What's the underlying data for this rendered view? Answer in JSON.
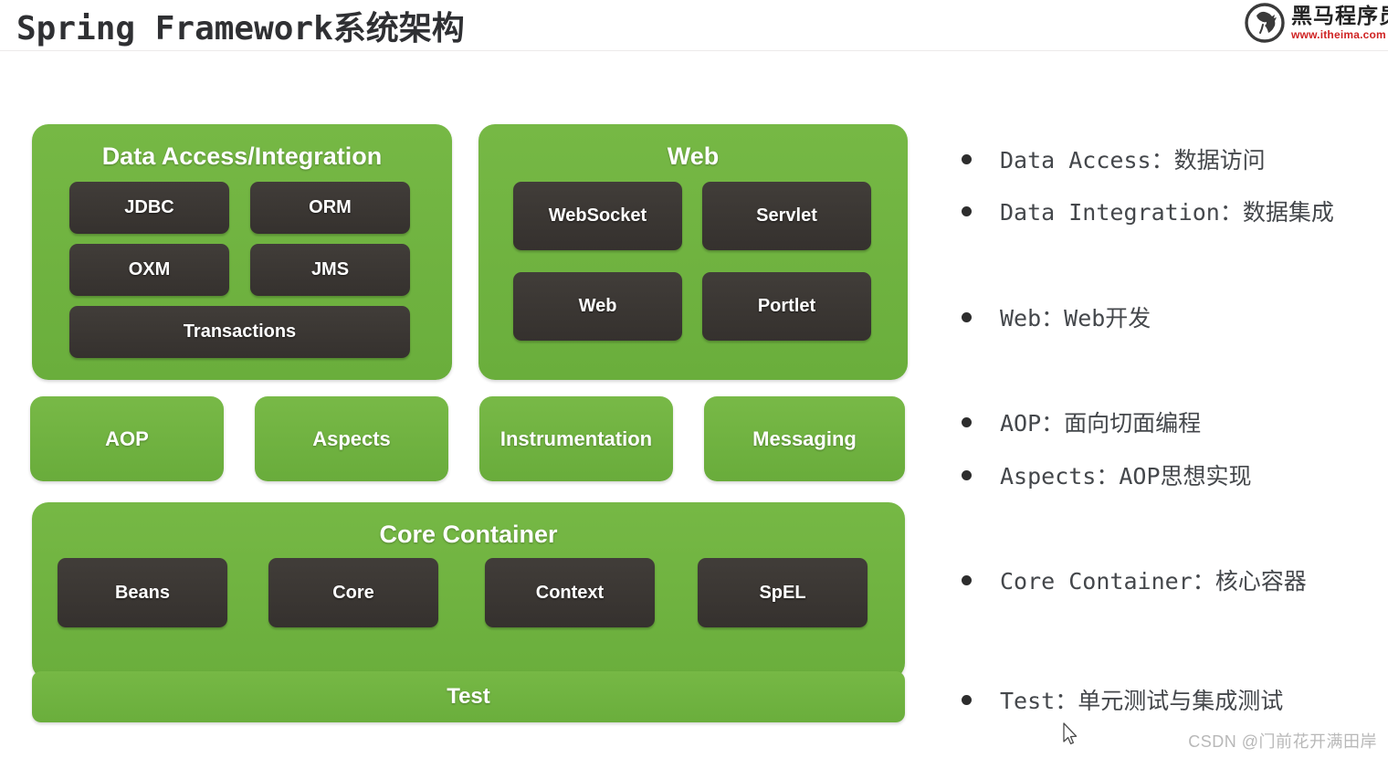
{
  "header": {
    "title": "Spring Framework系统架构",
    "brand": {
      "name": "黑马程序员",
      "url": "www.itheima.com"
    }
  },
  "diagram": {
    "panels": [
      {
        "id": "data-access-integration",
        "title": "Data Access/Integration",
        "modules": [
          "JDBC",
          "ORM",
          "OXM",
          "JMS",
          "Transactions"
        ]
      },
      {
        "id": "web",
        "title": "Web",
        "modules": [
          "WebSocket",
          "Servlet",
          "Web",
          "Portlet"
        ]
      },
      {
        "id": "core-container",
        "title": "Core Container",
        "modules": [
          "Beans",
          "Core",
          "Context",
          "SpEL"
        ]
      }
    ],
    "middle_row": [
      "AOP",
      "Aspects",
      "Instrumentation",
      "Messaging"
    ],
    "test_bar": "Test",
    "colors": {
      "green": "#6fb240",
      "dark": "#3a3633",
      "text_on_green": "#ffffff",
      "text_on_dark": "#ffffff"
    }
  },
  "notes": [
    {
      "label": "Data Access",
      "desc": "数据访问",
      "text": "Data Access：数据访问"
    },
    {
      "label": "Data Integration",
      "desc": "数据集成",
      "text": "Data Integration：数据集成"
    },
    {
      "label": "Web",
      "desc": "Web开发",
      "text": "Web：Web开发"
    },
    {
      "label": "AOP",
      "desc": "面向切面编程",
      "text": "AOP：面向切面编程"
    },
    {
      "label": "Aspects",
      "desc": "AOP思想实现",
      "text": "Aspects：AOP思想实现"
    },
    {
      "label": "Core Container",
      "desc": "核心容器",
      "text": "Core Container：核心容器"
    },
    {
      "label": "Test",
      "desc": "单元测试与集成测试",
      "text": "Test：单元测试与集成测试"
    }
  ],
  "watermark": "CSDN @门前花开满田岸"
}
